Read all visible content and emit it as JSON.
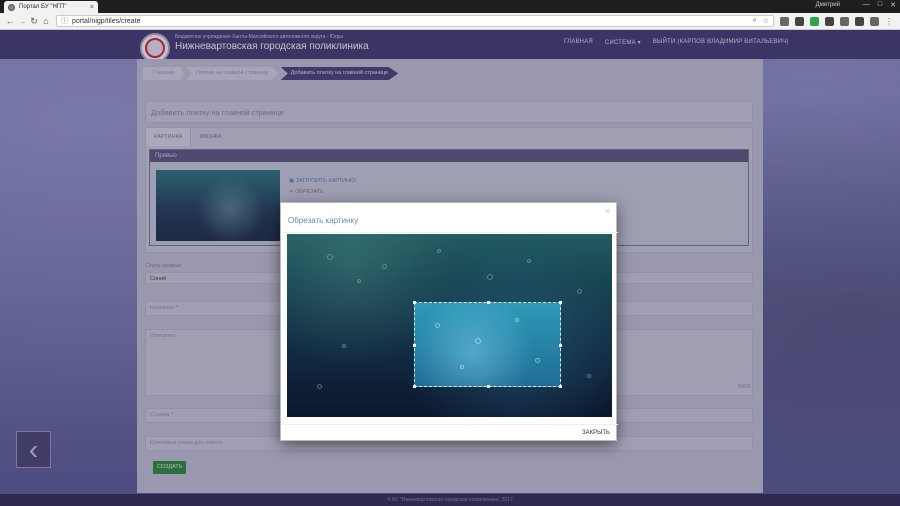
{
  "browser": {
    "tab_title": "Портал БУ \"НГП\"",
    "tab_close": "×",
    "user": "Дмитрий",
    "url": "portal/nigp/tiles/create",
    "info_icon": "ⓘ",
    "search_icon": "⌕",
    "star_icon": "☆",
    "back_icon": "←",
    "forward_icon": "→",
    "reload_icon": "↻",
    "home_icon": "⌂",
    "menu_icon": "⋮",
    "win_min": "—",
    "win_max": "□",
    "win_close": "✕"
  },
  "header": {
    "org_subtitle": "Бюджетное учреждение Ханты-Мансийского автономного округа - Югры",
    "org_name": "Нижневартовская городская поликлиника",
    "nav": [
      "ГЛАВНАЯ",
      "СИСТЕМА ▾",
      "ВЫЙТИ (КАРПОВ ВЛАДИМИР ВИТАЛЬЕВИЧ)"
    ]
  },
  "breadcrumb": [
    "Главная",
    "Плитки на главной странице",
    "Добавить плитку на главной странице"
  ],
  "page": {
    "title": "Добавить плитку на главной странице",
    "tabs": [
      "КАРТИНКА",
      "ИКОНКА"
    ],
    "preview_title": "Превью",
    "upload_label": "ЗАГРУЗИТЬ КАРТИНКУ",
    "crop_label": "ОБРЕЗАТЬ",
    "style_label": "Стиль превью",
    "style_value": "Синий",
    "name_label": "Название",
    "description_label": "Описание",
    "counter": "0/400",
    "link_label": "Ссылка",
    "keywords_label": "Ключевые слова для поиска",
    "required_mark": "*",
    "create_button": "СОЗДАТЬ",
    "back_arrow": "‹",
    "footer": "© БУ \"Нижневартовская городская поликлиника\" 2017"
  },
  "modal": {
    "title": "Обрезать картинку",
    "close_x": "×",
    "close_button": "ЗАКРЫТЬ"
  },
  "colors": {
    "header": "#433a72",
    "accent": "#4a4179",
    "create_button": "#2f8a3a",
    "modal_title": "#6f84b8"
  }
}
